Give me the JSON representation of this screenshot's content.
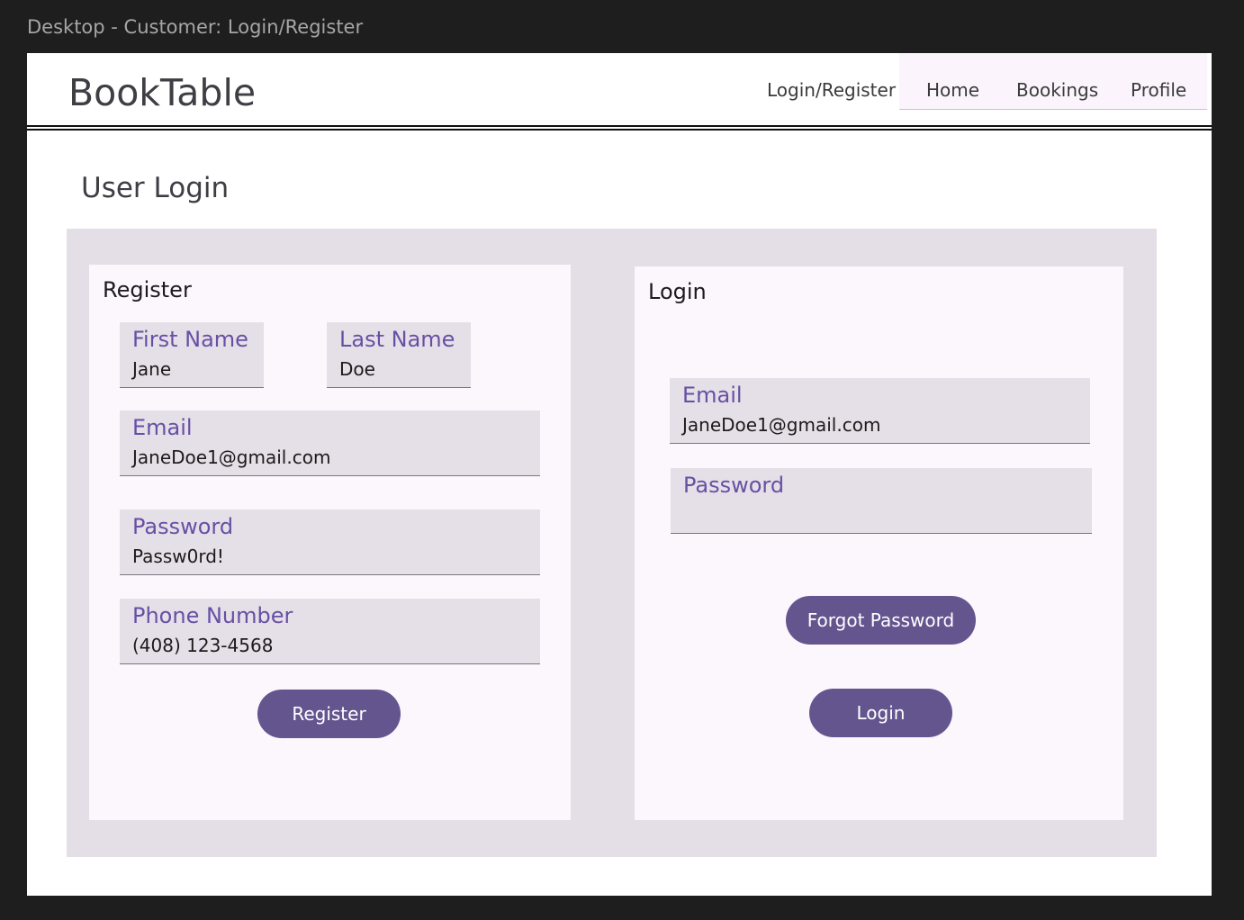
{
  "frame_label": "Desktop - Customer: Login/Register",
  "header": {
    "brand": "BookTable",
    "nav": {
      "login_register": "Login/Register",
      "home": "Home",
      "bookings": "Bookings",
      "profile": "Profile"
    }
  },
  "page_title": "User Login",
  "register": {
    "title": "Register",
    "first_name": {
      "label": "First Name",
      "value": "Jane"
    },
    "last_name": {
      "label": "Last Name",
      "value": "Doe"
    },
    "email": {
      "label": "Email",
      "value": "JaneDoe1@gmail.com"
    },
    "password": {
      "label": "Password",
      "value": "Passw0rd!"
    },
    "phone": {
      "label": "Phone Number",
      "value": "(408) 123-4568"
    },
    "button": "Register"
  },
  "login": {
    "title": "Login",
    "email": {
      "label": "Email",
      "value": "JaneDoe1@gmail.com"
    },
    "password": {
      "label": "Password",
      "value": ""
    },
    "forgot_button": "Forgot Password",
    "button": "Login"
  },
  "colors": {
    "accent": "#6750a4",
    "button": "#65558f",
    "panel": "#e4dfe6",
    "card": "#fcf6fd"
  }
}
